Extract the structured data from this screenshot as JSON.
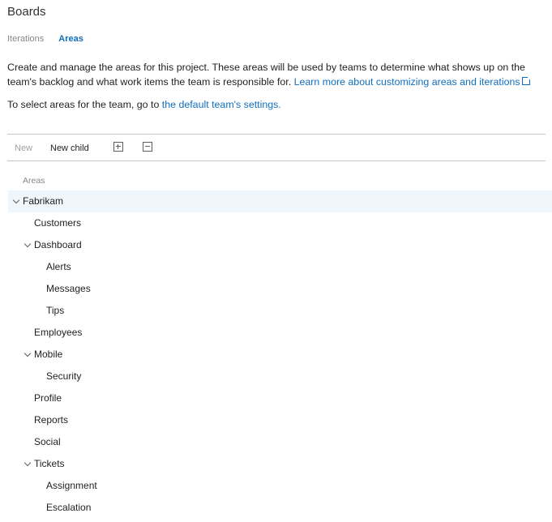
{
  "header": {
    "title": "Boards"
  },
  "tabs": [
    {
      "label": "Iterations",
      "active": false
    },
    {
      "label": "Areas",
      "active": true
    }
  ],
  "description": {
    "text": "Create and manage the areas for this project. These areas will be used by teams to determine what shows up on the team's backlog and what work items the team is responsible for. ",
    "link_text": "Learn more about customizing areas and iterations"
  },
  "select_note": {
    "prefix": "To select areas for the team, go to ",
    "link_text": "the default team's settings."
  },
  "toolbar": {
    "new_label": "New",
    "new_child_label": "New child",
    "expand_icon": "expand-all-icon",
    "collapse_icon": "collapse-all-icon"
  },
  "tree": {
    "header": "Areas",
    "nodes": [
      {
        "label": "Fabrikam",
        "expanded": true,
        "selected": true
      },
      {
        "label": "Customers"
      },
      {
        "label": "Dashboard",
        "expanded": true
      },
      {
        "label": "Alerts"
      },
      {
        "label": "Messages"
      },
      {
        "label": "Tips"
      },
      {
        "label": "Employees"
      },
      {
        "label": "Mobile",
        "expanded": true
      },
      {
        "label": "Security"
      },
      {
        "label": "Profile"
      },
      {
        "label": "Reports"
      },
      {
        "label": "Social"
      },
      {
        "label": "Tickets",
        "expanded": true
      },
      {
        "label": "Assignment"
      },
      {
        "label": "Escalation"
      }
    ]
  },
  "colors": {
    "link": "#106ebe",
    "selected_row": "#eff6fc",
    "muted": "#8a8886"
  }
}
